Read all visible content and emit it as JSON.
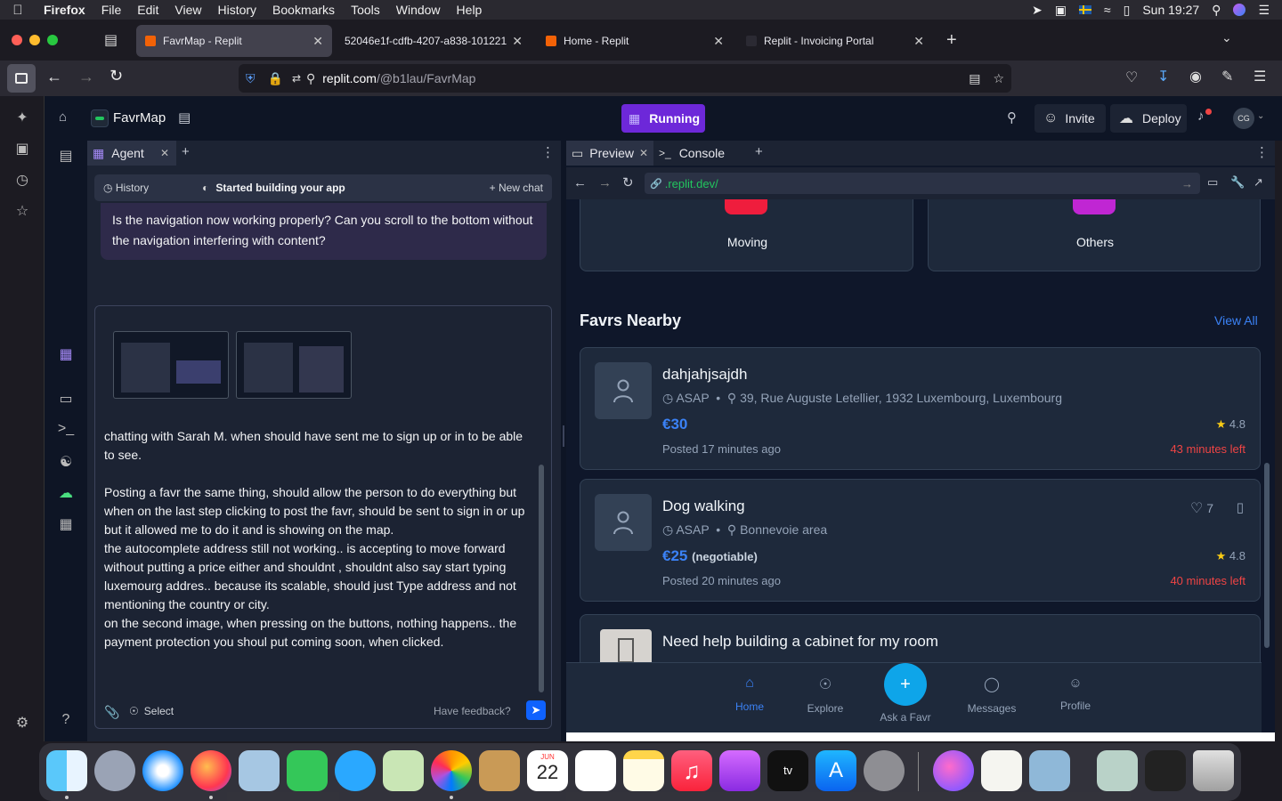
{
  "menubar": {
    "app": "Firefox",
    "items": [
      "File",
      "Edit",
      "View",
      "History",
      "Bookmarks",
      "Tools",
      "Window",
      "Help"
    ],
    "clock": "Sun 19:27"
  },
  "tabs": [
    {
      "title": "FavrMap - Replit",
      "active": true
    },
    {
      "title": "52046e1f-cdfb-4207-a838-101221",
      "active": false
    },
    {
      "title": "Home - Replit",
      "active": false
    },
    {
      "title": "Replit - Invoicing Portal",
      "active": false
    }
  ],
  "url": {
    "host": "replit.com",
    "path": "/@b1lau/FavrMap"
  },
  "replit": {
    "project": "FavrMap",
    "run_status": "Running",
    "invite": "Invite",
    "deploy": "Deploy",
    "avatar": "CG"
  },
  "agent": {
    "tab_label": "Agent",
    "history": "History",
    "status": "Started building your app",
    "new_chat": "New chat",
    "prev_message": "Is the navigation now working properly? Can you scroll to the bottom without the navigation interfering with content?",
    "draft_lines": [
      "chatting with Sarah M. when should have sent me to sign up or in to be able to see.",
      "",
      "Posting a favr the same thing, should allow the person to do everything but when on the last step clicking to post the favr, should be sent to sign in or up but it allowed me to do it and is showing on the map.",
      "the autocomplete address still not working.. is accepting to move forward without putting a price either and shouldnt , shouldnt also say start typing luxemourg addres.. because its scalable, should just Type address and not mentioning the country or city.",
      "on the second image, when pressing on the buttons, nothing happens.. the payment protection you shoul put coming soon, when clicked."
    ],
    "select": "Select",
    "feedback": "Have feedback?"
  },
  "preview": {
    "tab_preview": "Preview",
    "tab_console": "Console",
    "url": ".replit.dev/",
    "categories": [
      {
        "label": "Moving",
        "color": "#ef1d3d"
      },
      {
        "label": "Others",
        "color": "#c026d3"
      }
    ],
    "section_title": "Favrs Nearby",
    "view_all": "View All",
    "favrs": [
      {
        "title": "dahjahjsajdh",
        "time": "ASAP",
        "location": "39, Rue Auguste Letellier, 1932 Luxembourg, Luxembourg",
        "price": "€30",
        "negotiable": "",
        "posted": "Posted 17 minutes ago",
        "rating": "4.8",
        "left": "43 minutes left",
        "likes": ""
      },
      {
        "title": "Dog walking",
        "time": "ASAP",
        "location": "Bonnevoie area",
        "price": "€25",
        "negotiable": "(negotiable)",
        "posted": "Posted 20 minutes ago",
        "rating": "4.8",
        "left": "40 minutes left",
        "likes": "7"
      },
      {
        "title": "Need help building a cabinet for my room",
        "time": "",
        "location": "",
        "price": "",
        "negotiable": "",
        "posted": "",
        "rating": "",
        "left": "",
        "likes": ""
      }
    ],
    "bottom_nav": [
      "Home",
      "Explore",
      "Ask a Favr",
      "Messages",
      "Profile"
    ]
  },
  "dock": {
    "calendar_month": "JUN",
    "calendar_day": "22"
  }
}
